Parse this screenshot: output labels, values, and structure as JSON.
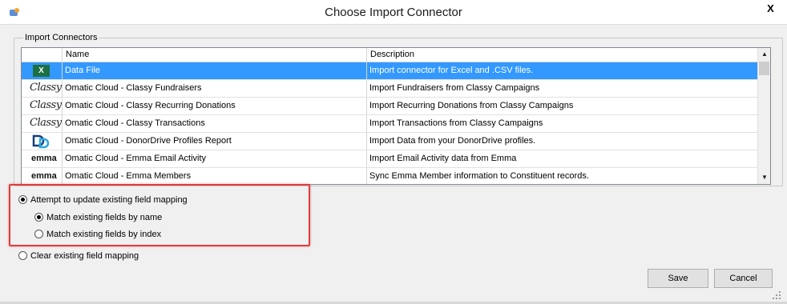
{
  "window": {
    "title": "Choose Import Connector",
    "close_label": "X"
  },
  "group": {
    "label": "Import Connectors"
  },
  "table": {
    "columns": [
      "",
      "Name",
      "Description"
    ],
    "rows": [
      {
        "icon": "excel-icon",
        "icon_text": "X",
        "name": "Data File",
        "description": "Import connector for Excel and .CSV files.",
        "selected": true
      },
      {
        "icon": "classy-logo-icon",
        "icon_text": "Classy",
        "name": "Omatic Cloud - Classy Fundraisers",
        "description": "Import Fundraisers from Classy Campaigns",
        "selected": false
      },
      {
        "icon": "classy-logo-icon",
        "icon_text": "Classy",
        "name": "Omatic Cloud - Classy Recurring Donations",
        "description": "Import Recurring Donations from Classy Campaigns",
        "selected": false
      },
      {
        "icon": "classy-logo-icon",
        "icon_text": "Classy",
        "name": "Omatic Cloud - Classy Transactions",
        "description": "Import Transactions from Classy Campaigns",
        "selected": false
      },
      {
        "icon": "donordrive-logo-icon",
        "icon_text": "",
        "name": "Omatic Cloud - DonorDrive Profiles Report",
        "description": "Import Data from your DonorDrive profiles.",
        "selected": false
      },
      {
        "icon": "emma-logo-icon",
        "icon_text": "emma",
        "name": "Omatic Cloud - Emma Email Activity",
        "description": "Import Email Activity data from Emma",
        "selected": false
      },
      {
        "icon": "emma-logo-icon",
        "icon_text": "emma",
        "name": "Omatic Cloud - Emma Members",
        "description": "Sync Emma Member information to Constituent records.",
        "selected": false
      }
    ]
  },
  "options": {
    "attempt_update": {
      "label": "Attempt to update existing field mapping",
      "checked": true
    },
    "match_by_name": {
      "label": "Match existing fields by name",
      "checked": true
    },
    "match_by_index": {
      "label": "Match existing fields by index",
      "checked": false
    },
    "clear_mapping": {
      "label": "Clear existing field mapping",
      "checked": false
    }
  },
  "buttons": {
    "save": "Save",
    "cancel": "Cancel"
  },
  "colors": {
    "selection": "#3399ff",
    "highlight": "#e23b3b",
    "excel": "#1d7044"
  }
}
